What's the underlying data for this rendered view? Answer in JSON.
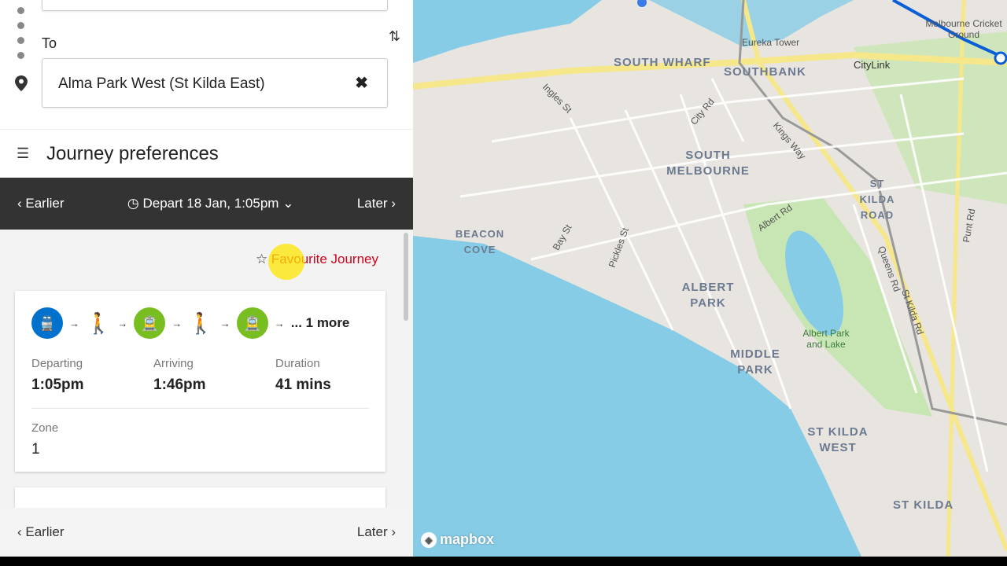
{
  "form": {
    "to_label": "To",
    "destination_value": "Alma Park West (St Kilda East)",
    "clear_icon": "close-icon",
    "swap_icon": "swap-icon"
  },
  "preferences": {
    "label": "Journey preferences"
  },
  "time_bar": {
    "earlier": "Earlier",
    "depart": "Depart 18 Jan, 1:05pm",
    "later": "Later"
  },
  "favourite": {
    "label": "Favourite Journey",
    "color": "#d0021b"
  },
  "journey": {
    "modes": [
      "train",
      "walk",
      "tram",
      "walk",
      "tram"
    ],
    "more": "... 1 more",
    "departing_label": "Departing",
    "departing": "1:05pm",
    "arriving_label": "Arriving",
    "arriving": "1:46pm",
    "duration_label": "Duration",
    "duration": "41 mins",
    "zone_label": "Zone",
    "zone": "1"
  },
  "bottom_bar": {
    "earlier": "Earlier",
    "later": "Later"
  },
  "colors": {
    "train": "#0072ce",
    "tram": "#78be20",
    "water": "#86cce6",
    "park": "#c8e6b4"
  },
  "map": {
    "suburbs": [
      "SOUTH WHARF",
      "SOUTHBANK",
      "SOUTH MELBOURNE",
      "ST KILDA ROAD",
      "BEACON COVE",
      "ALBERT PARK",
      "MIDDLE PARK",
      "ST KILDA WEST",
      "ST KILDA"
    ],
    "places": [
      "Eureka Tower",
      "Melbourne Cricket Ground",
      "CityLink",
      "Albert Park and Lake"
    ],
    "streets": [
      "Ingles St",
      "City Rd",
      "Kings Way",
      "Bay St",
      "Pickles St",
      "Albert Rd",
      "Queens Rd",
      "St Kilda Rd",
      "Punt Rd"
    ],
    "attribution": "mapbox"
  }
}
